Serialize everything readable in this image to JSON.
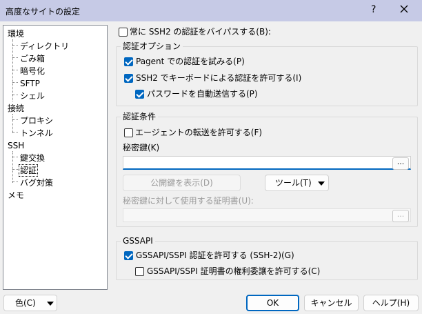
{
  "window": {
    "title": "高度なサイトの設定",
    "help_glyph": "?"
  },
  "tree": {
    "items": [
      {
        "label": "環境"
      },
      {
        "label": "ディレクトリ"
      },
      {
        "label": "ごみ箱"
      },
      {
        "label": "暗号化"
      },
      {
        "label": "SFTP"
      },
      {
        "label": "シェル"
      },
      {
        "label": "接続"
      },
      {
        "label": "プロキシ"
      },
      {
        "label": "トンネル"
      },
      {
        "label": "SSH"
      },
      {
        "label": "鍵交換"
      },
      {
        "label": "認証"
      },
      {
        "label": "バグ対策"
      },
      {
        "label": "メモ"
      }
    ],
    "selected": "認証"
  },
  "bypass": {
    "label": "常に SSH2 の認証をバイパスする(B):",
    "checked": false
  },
  "auth_options": {
    "title": "認証オプション",
    "pagent": {
      "label": "Pagent での認証を試みる(P)",
      "checked": true
    },
    "keyboard": {
      "label": "SSH2 でキーボードによる認証を許可する(I)",
      "checked": true
    },
    "autopw": {
      "label": "パスワードを自動送信する(P)",
      "checked": true
    }
  },
  "auth_conditions": {
    "title": "認証条件",
    "agent_forward": {
      "label": "エージェントの転送を許可する(F)",
      "checked": false
    },
    "private_key_label": "秘密鍵(K)",
    "private_key_value": "",
    "browse": "...",
    "show_public_key": "公開鍵を表示(D)",
    "tools": "ツール(T)",
    "cert_label": "秘密鍵に対して使用する証明書(U):",
    "cert_value": "",
    "cert_browse": "..."
  },
  "gssapi": {
    "title": "GSSAPI",
    "allow": {
      "label": "GSSAPI/SSPI 認証を許可する (SSH-2)(G)",
      "checked": true
    },
    "delegate": {
      "label": "GSSAPI/SSPI 証明書の権利委譲を許可する(C)",
      "checked": false
    }
  },
  "footer": {
    "color": "色(C)",
    "ok": "OK",
    "cancel": "キャンセル",
    "help": "ヘルプ(H)"
  }
}
